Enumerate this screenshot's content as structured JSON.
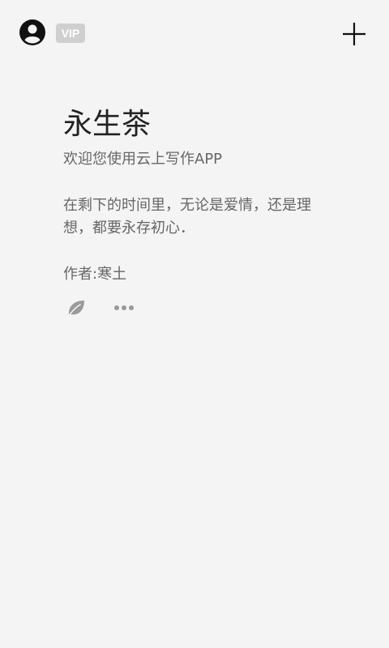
{
  "header": {
    "vip_label": "VIP",
    "icons": {
      "account": "account-circle-icon",
      "add": "plus-icon"
    }
  },
  "card": {
    "title": "永生茶",
    "subtitle": "欢迎您使用云上写作APP",
    "quote": "在剩下的时间里，无论是爱情，还是理想，都要永存初心．",
    "author": "作者:寒土",
    "actions": {
      "leaf": "leaf-icon",
      "more": "more-dots-icon"
    }
  },
  "colors": {
    "background": "#f4f4f4",
    "title": "#222222",
    "body_text": "#666666",
    "vip_badge": "#cfcfcf",
    "icon_gray": "#999999"
  }
}
